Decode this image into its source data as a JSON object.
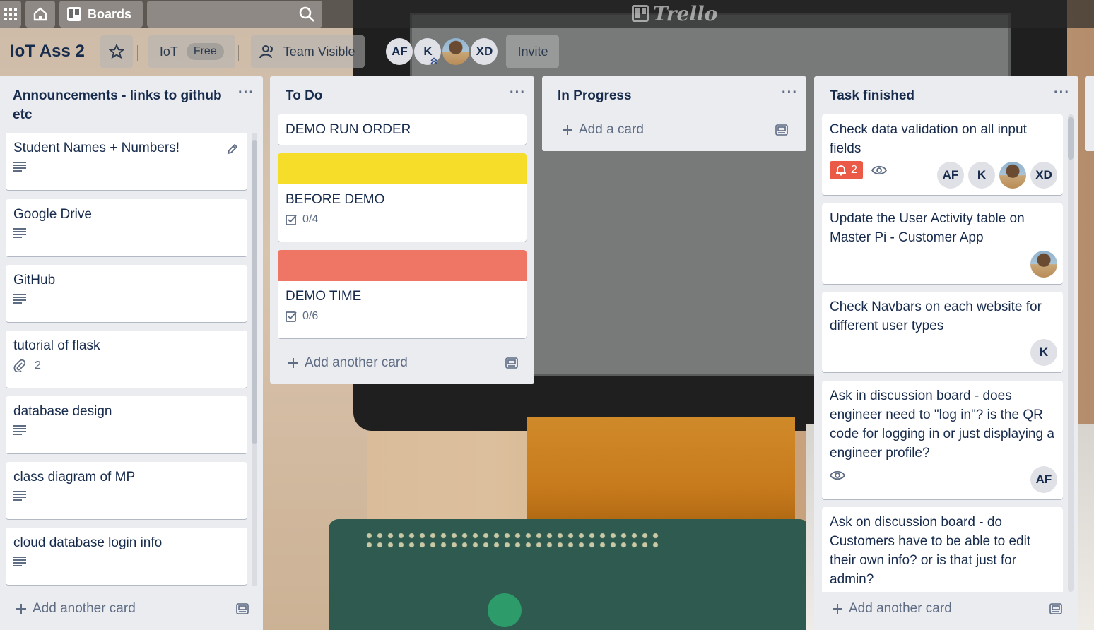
{
  "topbar": {
    "boards_label": "Boards",
    "logo_text": "Trello"
  },
  "board": {
    "title": "IoT Ass 2",
    "team_name": "IoT",
    "plan_badge": "Free",
    "visibility_label": "Team Visible",
    "members": [
      "AF",
      "K",
      "",
      "XD"
    ],
    "invite_label": "Invite"
  },
  "lists": [
    {
      "title": "Announcements - links to github etc",
      "cards": [
        {
          "title": "Student Names + Numbers!"
        },
        {
          "title": "Google Drive"
        },
        {
          "title": "GitHub"
        },
        {
          "title": "tutorial of flask",
          "attachments": "2"
        },
        {
          "title": "database design"
        },
        {
          "title": "class diagram of MP"
        },
        {
          "title": "cloud database login info"
        }
      ],
      "add_label": "Add another card"
    },
    {
      "title": "To Do",
      "cards": [
        {
          "title": "DEMO RUN ORDER"
        },
        {
          "title": "BEFORE DEMO",
          "checklist": "0/4",
          "cover_color": "#f5dd29"
        },
        {
          "title": "DEMO TIME",
          "checklist": "0/6",
          "cover_color": "#ef7564"
        }
      ],
      "add_label": "Add another card"
    },
    {
      "title": "In Progress",
      "cards": [],
      "add_label": "Add a card"
    },
    {
      "title": "Task finished",
      "cards": [
        {
          "title": "Check data validation on all input fields",
          "notifications": "2",
          "members": [
            "AF",
            "K",
            "",
            "XD"
          ]
        },
        {
          "title": "Update the User Activity table on Master Pi - Customer App",
          "members": [
            ""
          ]
        },
        {
          "title": "Check Navbars on each website for different user types",
          "members": [
            "K"
          ]
        },
        {
          "title": "Ask in discussion board - does engineer need to \"log in\"? is the QR code for logging in or just displaying a engineer profile?",
          "members": [
            "AF"
          ]
        },
        {
          "title": "Ask on discussion board - do Customers have to be able to edit their own info? or is that just for admin?"
        }
      ],
      "add_label": "Add another card"
    }
  ],
  "colors": {
    "list_bg": "#ebecf0",
    "card_text": "#172b4d",
    "due_badge": "#eb5a46",
    "yellow_label": "#f5dd29",
    "red_label": "#ef7564"
  },
  "icons": [
    "apps-icon",
    "home-icon",
    "boards-icon",
    "search-icon",
    "trello-logo-icon",
    "star-icon",
    "team-visible-icon",
    "list-menu-icon",
    "description-icon",
    "edit-icon",
    "attachment-icon",
    "checklist-icon",
    "bell-icon",
    "watch-icon",
    "plus-icon",
    "card-template-icon"
  ]
}
